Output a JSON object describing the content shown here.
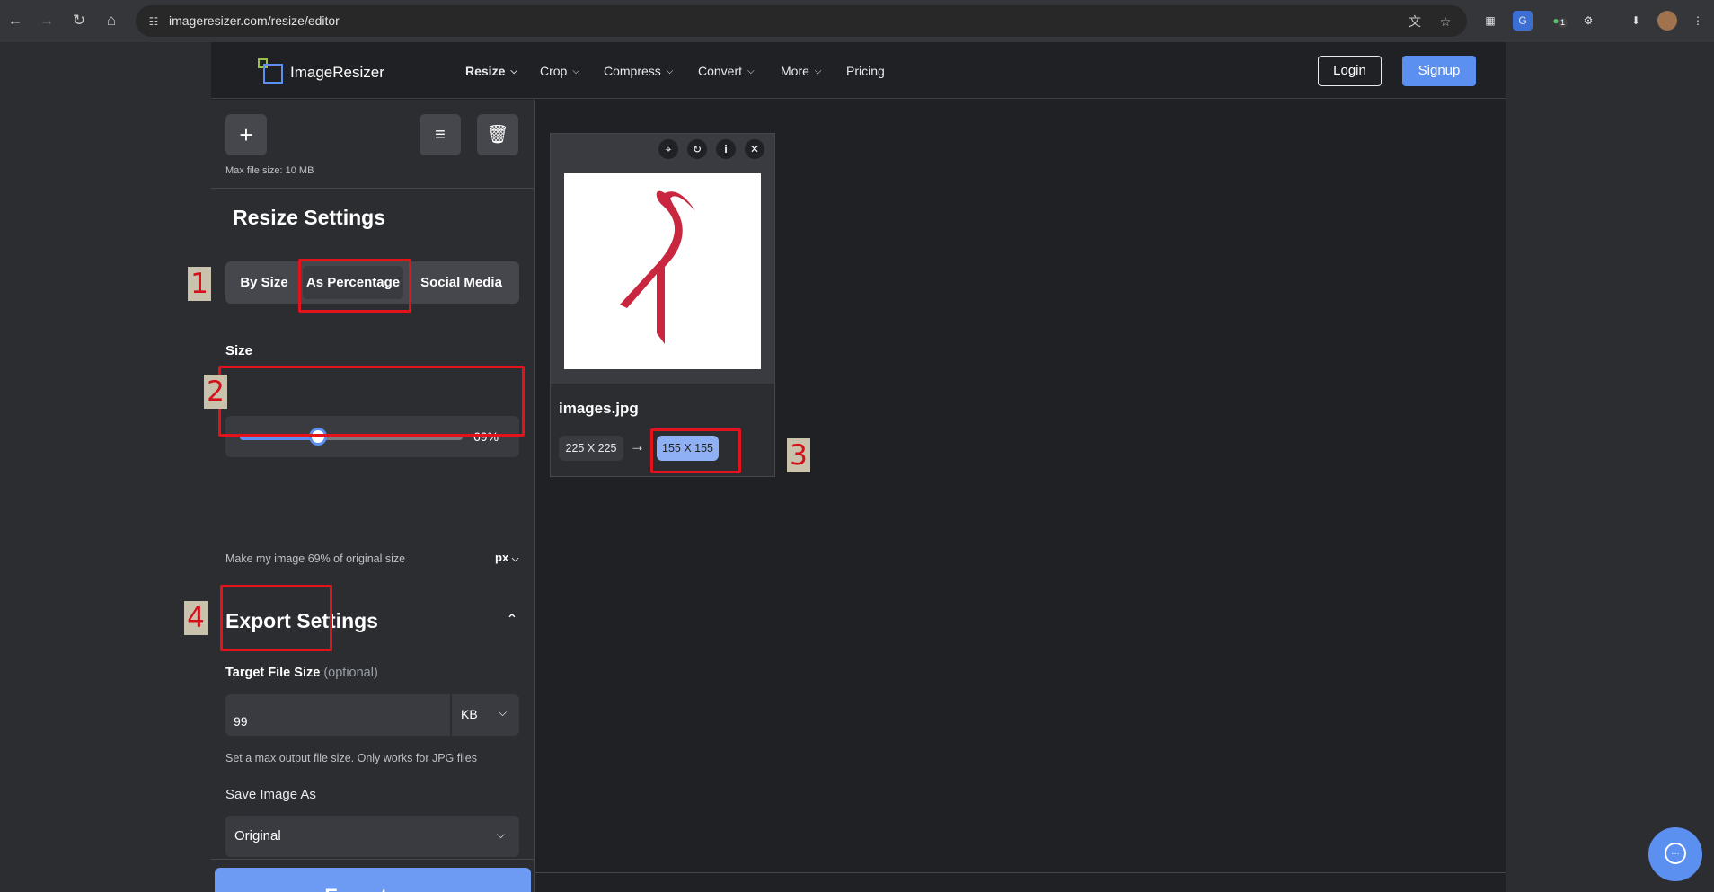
{
  "browser": {
    "url": "imageresizer.com/resize/editor",
    "icons": [
      "back-icon",
      "forward-icon",
      "reload-icon",
      "home-icon",
      "site-info-icon",
      "translate-icon",
      "bookmark-star-icon"
    ],
    "extensions": [
      "qr-icon",
      "translate-ext-icon",
      "chat-ext-icon",
      "puzzle-icon",
      "download-icon",
      "profile-avatar",
      "kebab-menu-icon"
    ],
    "extension_badge": "1"
  },
  "header": {
    "brand": "ImageResizer",
    "nav": [
      {
        "label": "Resize",
        "has_dropdown": true
      },
      {
        "label": "Crop",
        "has_dropdown": true
      },
      {
        "label": "Compress",
        "has_dropdown": true
      },
      {
        "label": "Convert",
        "has_dropdown": true
      },
      {
        "label": "More",
        "has_dropdown": true
      },
      {
        "label": "Pricing",
        "has_dropdown": false
      }
    ],
    "login": "Login",
    "signup": "Signup"
  },
  "sidebar": {
    "max_file_size": "Max file size: 10 MB",
    "resize_title": "Resize Settings",
    "modes": [
      "By Size",
      "As Percentage",
      "Social Media"
    ],
    "active_mode": "As Percentage",
    "size_label": "Size",
    "slider_value_pct": 69,
    "slider_readout": "69%",
    "size_hint": "Make my image 69% of original size",
    "unit": "px",
    "export_title": "Export Settings",
    "target_label": "Target File Size",
    "target_optional": "(optional)",
    "target_value": "99",
    "target_unit": "KB",
    "target_hint": "Set a max output file size. Only works for JPG files",
    "save_as_label": "Save Image As",
    "save_as_value": "Original",
    "export_button": "Export"
  },
  "image_card": {
    "filename": "images.jpg",
    "original_dims": "225 X 225",
    "new_dims": "155 X 155",
    "toolbar": [
      "crop-icon",
      "rotate-icon",
      "info-icon",
      "close-icon"
    ]
  },
  "annotations": [
    "1",
    "2",
    "3",
    "4"
  ],
  "colors": {
    "accent": "#5b8ff0",
    "annotation": "#e3121b",
    "logo_bird": "#c8273f"
  }
}
